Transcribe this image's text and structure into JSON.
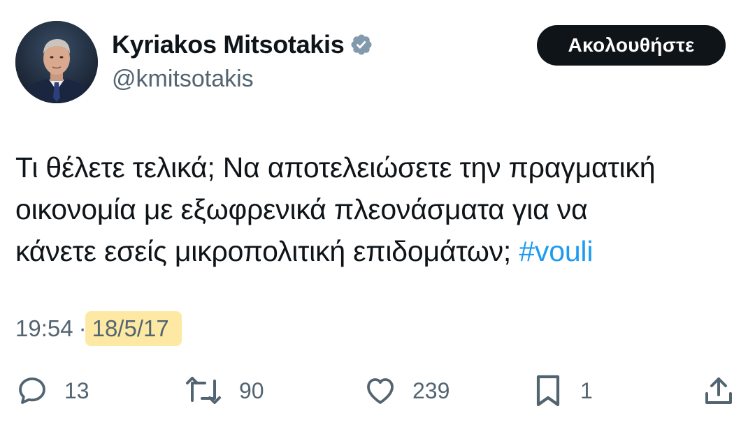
{
  "author": {
    "display_name": "Kyriakos Mitsotakis",
    "handle": "@kmitsotakis",
    "verified": true,
    "avatar_icon": "avatar-icon",
    "verified_icon": "verified-badge-icon"
  },
  "follow_button": {
    "label": "Ακολουθήστε"
  },
  "tweet": {
    "line1": "Τι θέλετε τελικά; Να αποτελειώσετε την πραγματική",
    "line2": "οικονομία με εξωφρενικά πλεονάσματα για να",
    "line3": "κάνετε εσείς μικροπολιτική επιδομάτων;",
    "hashtag": "#vouli"
  },
  "meta": {
    "time": "19:54",
    "separator": "·",
    "date": "18/5/17",
    "date_highlight_color": "#fde9a4"
  },
  "actions": {
    "replies": {
      "count": "13",
      "icon": "reply-icon"
    },
    "retweets": {
      "count": "90",
      "icon": "retweet-icon"
    },
    "likes": {
      "count": "239",
      "icon": "heart-icon"
    },
    "bookmarks": {
      "count": "1",
      "icon": "bookmark-icon"
    },
    "share": {
      "icon": "share-icon"
    }
  },
  "colors": {
    "text": "#0f1419",
    "secondary": "#536471",
    "accent": "#1d9bf0",
    "button_bg": "#0f1419",
    "button_text": "#ffffff",
    "verified_badge": "#829aab"
  }
}
